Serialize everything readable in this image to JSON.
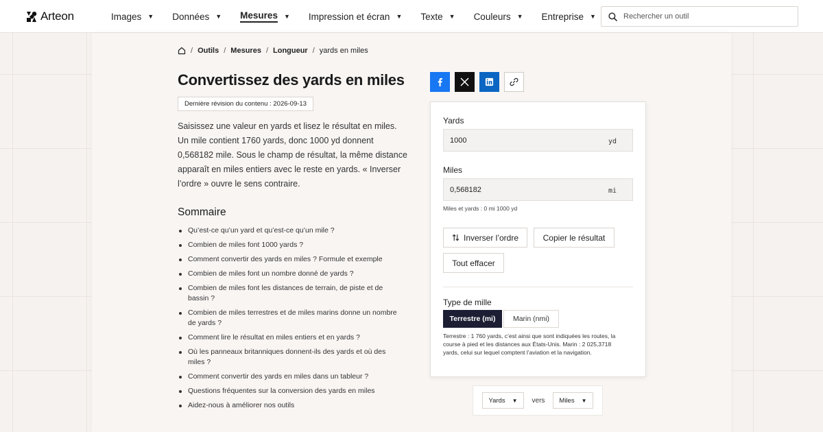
{
  "brand": {
    "name": "Arteon"
  },
  "nav": {
    "items": [
      {
        "label": "Images"
      },
      {
        "label": "Données"
      },
      {
        "label": "Mesures",
        "active": true
      },
      {
        "label": "Impression et écran"
      },
      {
        "label": "Texte"
      },
      {
        "label": "Couleurs"
      },
      {
        "label": "Entreprise"
      }
    ]
  },
  "search": {
    "placeholder": "Rechercher un outil",
    "value": ""
  },
  "breadcrumb": {
    "items": [
      "Outils",
      "Mesures",
      "Longueur"
    ],
    "current": "yards en miles"
  },
  "page": {
    "title": "Convertissez des yards en miles",
    "revision": "Dernière révision du contenu : 2026-09-13",
    "intro": "Saisissez une valeur en yards et lisez le résultat en miles. Un mile contient 1760 yards, donc 1000 yd donnent 0,568182 mile. Sous le champ de résultat, la même distance apparaît en miles entiers avec le reste en yards. « Inverser l’ordre » ouvre le sens contraire."
  },
  "toc": {
    "title": "Sommaire",
    "items": [
      "Qu’est-ce qu’un yard et qu’est-ce qu’un mile ?",
      "Combien de miles font 1000 yards ?",
      "Comment convertir des yards en miles ? Formule et exemple",
      "Combien de miles font un nombre donné de yards ?",
      "Combien de miles font les distances de terrain, de piste et de bassin ?",
      "Combien de miles terrestres et de miles marins donne un nombre de yards ?",
      "Comment lire le résultat en miles entiers et en yards ?",
      "Où les panneaux britanniques donnent-ils des yards et où des miles ?",
      "Comment convertir des yards en miles dans un tableur ?",
      "Questions fréquentes sur la conversion des yards en miles",
      "Aidez-nous à améliorer nos outils"
    ]
  },
  "share": {
    "icons": [
      "facebook-icon",
      "x-icon",
      "linkedin-icon",
      "link-icon"
    ]
  },
  "converter": {
    "from": {
      "label": "Yards",
      "value": "1000",
      "unit": "yd"
    },
    "to": {
      "label": "Miles",
      "value": "0,568182",
      "unit": "mi"
    },
    "hint": "Miles et yards : 0 mi 1000 yd",
    "buttons": {
      "swap": "Inverser l’ordre",
      "copy": "Copier le résultat",
      "clear": "Tout effacer"
    },
    "mile_type": {
      "label": "Type de mille",
      "options": [
        "Terrestre (mi)",
        "Marin (nmi)"
      ],
      "selected": "Terrestre (mi)",
      "description": "Terrestre : 1 760 yards, c’est ainsi que sont indiquées les routes, la course à pied et les distances aux États-Unis. Marin : 2 025,3718 yards, celui sur lequel comptent l’aviation et la navigation."
    }
  },
  "direction": {
    "from": "Yards",
    "connector": "vers",
    "to": "Miles"
  },
  "colors": {
    "accent": "#1c1f33",
    "facebook": "#1877f2",
    "x": "#111111",
    "linkedin": "#0a66c2"
  }
}
